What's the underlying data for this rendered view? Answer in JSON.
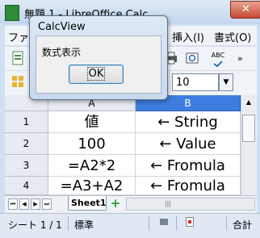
{
  "window": {
    "title": "無題 1 - LibreOffice Calc",
    "close_glyph": "✕"
  },
  "menu": {
    "left_item": "ファ",
    "insert": "挿入(I)",
    "format": "書式(O)"
  },
  "toolbar": {
    "font_size": "10",
    "spellcheck_label": "ABC"
  },
  "columns": [
    "A",
    "B"
  ],
  "rows": [
    {
      "num": "1",
      "a": "値",
      "b": "← String"
    },
    {
      "num": "2",
      "a": "100",
      "b": "← Value"
    },
    {
      "num": "3",
      "a": "=A2*2",
      "b": "← Fromula"
    },
    {
      "num": "4",
      "a": "=A3+A2",
      "b": "← Fromula"
    }
  ],
  "sheet_tabs": [
    {
      "label": "Sheet1"
    }
  ],
  "status": {
    "sheet": "シート 1 / 1",
    "style": "標準",
    "sum_label": "合計"
  },
  "dialog": {
    "title": "CalcView",
    "message": "数式表示",
    "ok_label": "OK"
  },
  "colors": {
    "selected_column_header": "#3d7de0",
    "title_bar": "#c3d6ec",
    "close_button": "#c74a34"
  }
}
